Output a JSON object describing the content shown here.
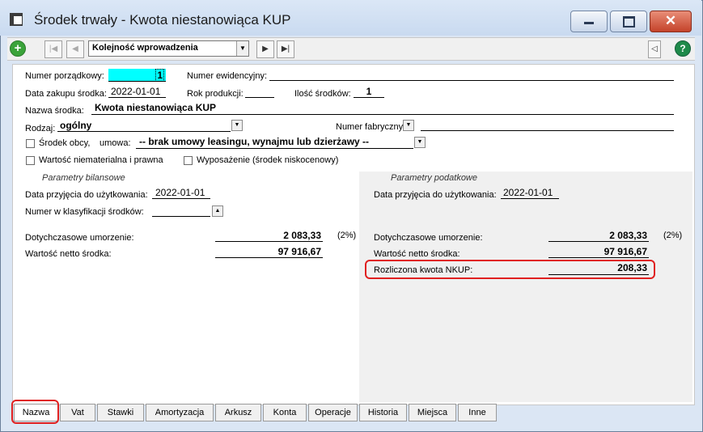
{
  "window": {
    "title": "Środek trwały - Kwota niestanowiąca KUP",
    "min_icon": "minimize-icon",
    "max_icon": "maximize-icon",
    "close_icon": "close-icon"
  },
  "toolbar": {
    "order_select": "Kolejność wprowadzenia",
    "add_icon": "plus-icon",
    "help_icon": "help-icon"
  },
  "form": {
    "numer_porzadkowy_label": "Numer porządkowy:",
    "numer_porzadkowy_value": "1",
    "numer_ewidencyjny_label": "Numer ewidencyjny:",
    "numer_ewidencyjny_value": "",
    "data_zakupu_label": "Data zakupu środka:",
    "data_zakupu_value": "2022-01-01",
    "rok_produkcji_label": "Rok produkcji:",
    "rok_produkcji_value": "",
    "ilosc_srodkow_label": "Ilość środków:",
    "ilosc_srodkow_value": "1",
    "nazwa_label": "Nazwa środka:",
    "nazwa_value": "Kwota niestanowiąca KUP",
    "rodzaj_label": "Rodzaj:",
    "rodzaj_value": "ogólny",
    "numer_fabryczny_label": "Numer fabryczny",
    "numer_fabryczny_value": "",
    "srodek_obcy_label": "Środek obcy,",
    "umowa_label": "umowa:",
    "umowa_value": "-- brak umowy leasingu, wynajmu lub dzierżawy --",
    "wartosc_niematerialna_label": "Wartość niematerialna i prawna",
    "wyposazenie_label": "Wyposażenie (środek niskocenowy)"
  },
  "bilansowe": {
    "header": "Parametry bilansowe",
    "data_przyjecia_label": "Data przyjęcia do użytkowania:",
    "data_przyjecia_value": "2022-01-01",
    "klasyfikacja_label": "Numer w klasyfikacji środków:",
    "klasyfikacja_value": "",
    "umorzenie_label": "Dotychczasowe umorzenie:",
    "umorzenie_value": "2 083,33",
    "umorzenie_pct": "(2%)",
    "netto_label": "Wartość netto środka:",
    "netto_value": "97 916,67"
  },
  "podatkowe": {
    "header": "Parametry podatkowe",
    "data_przyjecia_label": "Data przyjęcia do użytkowania:",
    "data_przyjecia_value": "2022-01-01",
    "umorzenie_label": "Dotychczasowe umorzenie:",
    "umorzenie_value": "2 083,33",
    "umorzenie_pct": "(2%)",
    "netto_label": "Wartość netto środka:",
    "netto_value": "97 916,67",
    "nkup_label": "Rozliczona kwota NKUP:",
    "nkup_value": "208,33"
  },
  "tabs": [
    "Nazwa",
    "Vat",
    "Stawki",
    "Amortyzacja",
    "Arkusz",
    "Konta",
    "Operacje",
    "Historia",
    "Miejsca",
    "Inne"
  ],
  "colors": {
    "highlight": "#e02020",
    "selected_field": "#00ffff",
    "add_button": "#3aa33a",
    "help_button": "#1e8a4a"
  }
}
